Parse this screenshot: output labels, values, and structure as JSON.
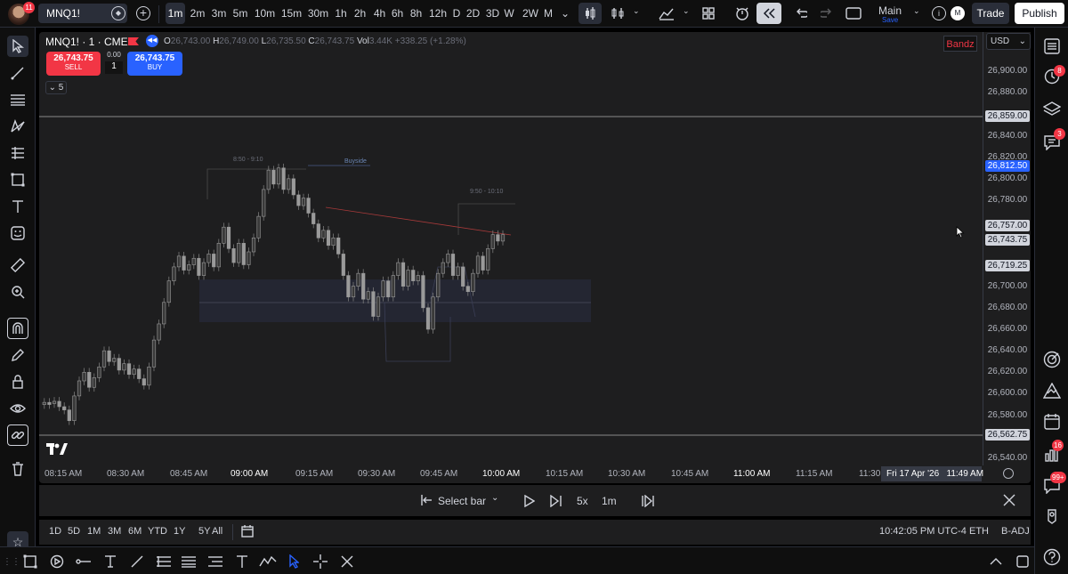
{
  "header": {
    "avatar_badge": "11",
    "symbol": "MNQ1!",
    "intervals": [
      "1m",
      "2m",
      "3m",
      "5m",
      "10m",
      "15m",
      "30m",
      "1h",
      "2h",
      "4h",
      "6h",
      "8h",
      "12h",
      "D",
      "2D",
      "3D",
      "W",
      "2W",
      "M"
    ],
    "active_interval": "1m",
    "layout_name": "Main",
    "layout_status": "Save",
    "account_initial": "M",
    "trade_label": "Trade",
    "publish_label": "Publish"
  },
  "legend": {
    "title": "MNQ1! · 1 · CME",
    "o_label": "O",
    "o_value": "26,743.00",
    "h_label": "H",
    "h_value": "26,749.00",
    "l_label": "L",
    "l_value": "26,735.50",
    "c_label": "C",
    "c_value": "26,743.75",
    "vol_label": "Vol",
    "vol_value": "3.44K",
    "change": "+338.25 (+1.28%)",
    "sell_price": "26,743.75",
    "sell_label": "SELL",
    "spread": "0.00",
    "qty": "1",
    "buy_price": "26,743.75",
    "buy_label": "BUY",
    "indicator_count": "5",
    "indicator_tag": "Bandz"
  },
  "currency": "USD",
  "price_scale": {
    "labels": [
      "26,900.00",
      "26,880.00",
      "26,840.00",
      "26,820.00",
      "26,800.00",
      "26,780.00",
      "26,700.00",
      "26,680.00",
      "26,660.00",
      "26,640.00",
      "26,620.00",
      "26,600.00",
      "26,580.00",
      "26,540.00"
    ],
    "tag_859": "26,859.00",
    "tag_812": "26,812.50",
    "tag_757": "26,757.00",
    "tag_743": "26,743.75",
    "tag_719": "26,719.25",
    "tag_562": "26,562.75"
  },
  "time_scale": {
    "labels": [
      "08:15 AM",
      "08:30 AM",
      "08:45 AM",
      "09:00 AM",
      "09:15 AM",
      "09:30 AM",
      "09:45 AM",
      "10:00 AM",
      "10:15 AM",
      "10:30 AM",
      "10:45 AM",
      "11:00 AM",
      "11:15 AM",
      "11:30"
    ],
    "current": "Fri 17 Apr '26",
    "current_time": "11:49 AM"
  },
  "annotations": {
    "range1": "8:50 - 9:10",
    "buyside": "Buyside",
    "range2": "9:50 - 10:10"
  },
  "replay": {
    "select_bar": "Select bar",
    "speed": "5x",
    "interval": "1m"
  },
  "bottom": {
    "ranges": [
      "1D",
      "5D",
      "1M",
      "3M",
      "6M",
      "YTD",
      "1Y",
      "5Y",
      "All"
    ],
    "clock": "10:42:05 PM UTC-4",
    "session": "ETH",
    "adjust": "B-ADJ"
  },
  "right_badges": {
    "alerts": "8",
    "chats": "3",
    "notifications": "16",
    "messages": "99+"
  },
  "colors": {
    "sell": "#f23645",
    "buy": "#2962ff",
    "bg": "#1e1e1f",
    "candle": "#9a9a9a"
  }
}
